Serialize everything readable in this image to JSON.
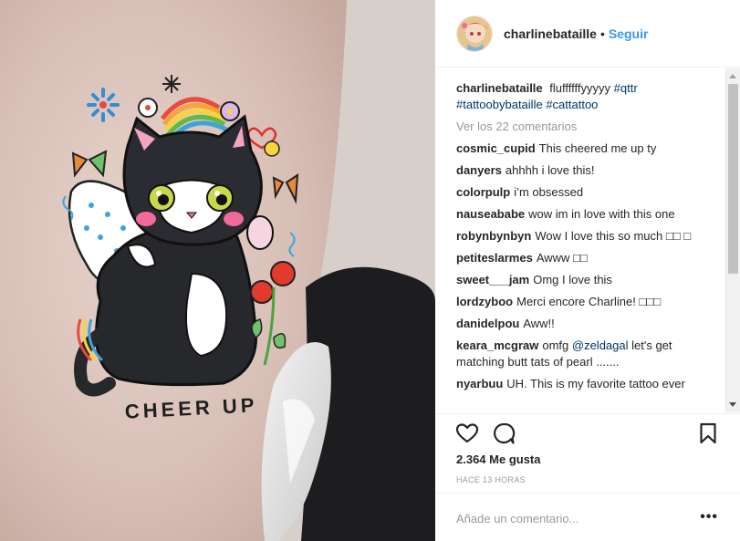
{
  "post": {
    "username": "charlinebataille",
    "dot": "•",
    "follow_label": "Seguir",
    "photo": {
      "tattoo_text": "CHEER UP"
    }
  },
  "caption": {
    "username": "charlinebataille",
    "text": "fluffffffyyyyy",
    "tag1": "#qttr",
    "tag2": "#tattoobybataille",
    "tag3": "#cattattoo"
  },
  "view_all": "Ver los 22 comentarios",
  "comments": [
    {
      "user": "cosmic_cupid",
      "text": "This cheered me up ty"
    },
    {
      "user": "danyers",
      "text": "ahhhh i love this!"
    },
    {
      "user": "colorpulp",
      "text": "i’m obsessed"
    },
    {
      "user": "nauseababe",
      "text": "wow im in love with this one"
    },
    {
      "user": "robynbynbyn",
      "text": "Wow I love this so much □□ □"
    },
    {
      "user": "petiteslarmes",
      "text": "Awww □□"
    },
    {
      "user": "sweet___jam",
      "text": "Omg I love this"
    },
    {
      "user": "lordzyboo",
      "text": "Merci encore Charline! □□□"
    },
    {
      "user": "danidelpou",
      "text": "Aww!!"
    },
    {
      "user": "keara_mcgraw",
      "text": "omfg",
      "mention": "@zeldagal",
      "text2": "let's get matching butt tats of pearl ......."
    },
    {
      "user": "nyarbuu",
      "text": "UH. This is my favorite tattoo ever"
    }
  ],
  "likes": "2.364 Me gusta",
  "timestamp": "HACE 13 HORAS",
  "add_comment_placeholder": "Añade un comentario...",
  "more_label": "•••",
  "icons": {
    "like": "heart-icon",
    "comment": "speech-bubble-icon",
    "save": "bookmark-icon",
    "more": "ellipsis-icon"
  },
  "colors": {
    "follow": "#3897f0",
    "hashtag": "#003569",
    "muted": "#999999",
    "text": "#262626"
  }
}
